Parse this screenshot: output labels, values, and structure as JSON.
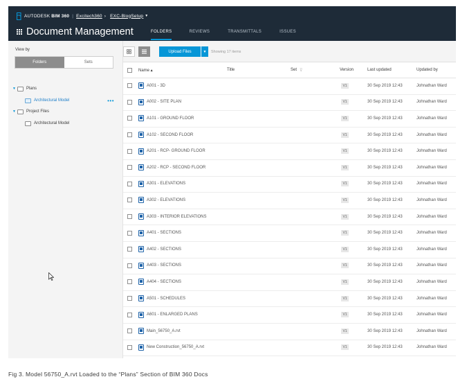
{
  "header": {
    "brand": "AUTODESK",
    "product": "BIM 360",
    "project": "Excitech360",
    "separator": "›",
    "subproject": "EXC-BlogSetup",
    "app_title": "Document Management",
    "tabs": [
      {
        "label": "FOLDERS",
        "active": true
      },
      {
        "label": "REVIEWS",
        "active": false
      },
      {
        "label": "TRANSMITTALS",
        "active": false
      },
      {
        "label": "ISSUES",
        "active": false
      }
    ]
  },
  "sidebar": {
    "view_by": "View by",
    "toggle": {
      "folders": "Folders",
      "sets": "Sets",
      "active": "Folders"
    },
    "tree": [
      {
        "label": "Plans",
        "expanded": true
      },
      {
        "label": "Architectural Model",
        "selected": true,
        "more": "•••"
      },
      {
        "label": "Project Files",
        "expanded": true
      },
      {
        "label": "Architectural Model",
        "selected": false
      }
    ]
  },
  "toolbar": {
    "upload_label": "Upload Files",
    "showing": "Showing 17 items"
  },
  "table": {
    "columns": {
      "name": "Name ▴",
      "title": "Title",
      "set": "Set",
      "version": "Version",
      "updated": "Last updated",
      "updated_by": "Updated by"
    },
    "rows": [
      {
        "name": "A001 - 3D",
        "version": "V1",
        "updated": "30 Sep 2019 12:43",
        "by": "Johnathan Ward"
      },
      {
        "name": "A002 - SITE PLAN",
        "version": "V1",
        "updated": "30 Sep 2019 12:43",
        "by": "Johnathan Ward"
      },
      {
        "name": "A101 - GROUND FLOOR",
        "version": "V1",
        "updated": "30 Sep 2019 12:43",
        "by": "Johnathan Ward"
      },
      {
        "name": "A102 - SECOND FLOOR",
        "version": "V1",
        "updated": "30 Sep 2019 12:43",
        "by": "Johnathan Ward"
      },
      {
        "name": "A201 - RCP- GROUND FLOOR",
        "version": "V1",
        "updated": "30 Sep 2019 12:43",
        "by": "Johnathan Ward"
      },
      {
        "name": "A202 - RCP - SECOND FLOOR",
        "version": "V1",
        "updated": "30 Sep 2019 12:43",
        "by": "Johnathan Ward"
      },
      {
        "name": "A301 - ELEVATIONS",
        "version": "V1",
        "updated": "30 Sep 2019 12:43",
        "by": "Johnathan Ward"
      },
      {
        "name": "A302 - ELEVATIONS",
        "version": "V1",
        "updated": "30 Sep 2019 12:43",
        "by": "Johnathan Ward"
      },
      {
        "name": "A303 - INTERIOR ELEVATIONS",
        "version": "V1",
        "updated": "30 Sep 2019 12:43",
        "by": "Johnathan Ward"
      },
      {
        "name": "A401 - SECTIONS",
        "version": "V1",
        "updated": "30 Sep 2019 12:43",
        "by": "Johnathan Ward"
      },
      {
        "name": "A402 - SECTIONS",
        "version": "V1",
        "updated": "30 Sep 2019 12:43",
        "by": "Johnathan Ward"
      },
      {
        "name": "A403 - SECTIONS",
        "version": "V1",
        "updated": "30 Sep 2019 12:43",
        "by": "Johnathan Ward"
      },
      {
        "name": "A404 - SECTIONS",
        "version": "V1",
        "updated": "30 Sep 2019 12:43",
        "by": "Johnathan Ward"
      },
      {
        "name": "A501 - SCHEDULES",
        "version": "V1",
        "updated": "30 Sep 2019 12:43",
        "by": "Johnathan Ward"
      },
      {
        "name": "A601 - ENLARGED PLANS",
        "version": "V1",
        "updated": "30 Sep 2019 12:43",
        "by": "Johnathan Ward"
      },
      {
        "name": "Main_56750_A.rvt",
        "version": "V1",
        "updated": "30 Sep 2019 12:43",
        "by": "Johnathan Ward"
      },
      {
        "name": "New Construction_56750_A.rvt",
        "version": "V1",
        "updated": "30 Sep 2019 12:43",
        "by": "Johnathan Ward"
      }
    ]
  },
  "caption": "Fig 3. Model 56750_A.rvt Loaded to the “Plans” Section of BIM 360 Docs",
  "colors": {
    "topbar": "#1e2b38",
    "accent": "#0696d7",
    "file_icon": "#1d62a8"
  }
}
